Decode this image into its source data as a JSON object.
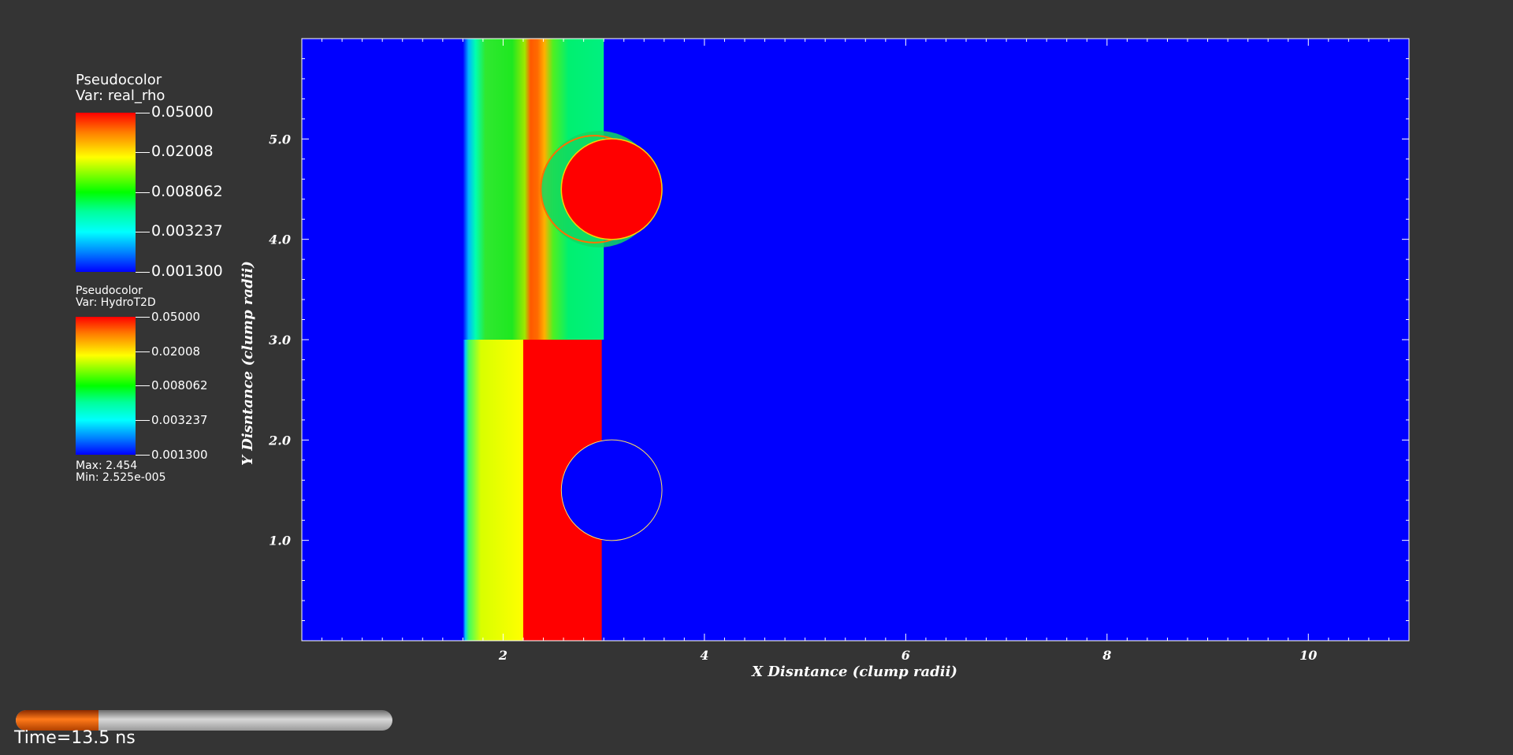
{
  "legend_top": {
    "title": "Pseudocolor",
    "var": "Var: real_rho",
    "ticks": [
      "0.05000",
      "0.02008",
      "0.008062",
      "0.003237",
      "0.001300"
    ]
  },
  "legend_bottom": {
    "title": "Pseudocolor",
    "var": "Var: HydroT2D",
    "ticks": [
      "0.05000",
      "0.02008",
      "0.008062",
      "0.003237",
      "0.001300"
    ],
    "max": "Max:  2.454",
    "min": "Min:  2.525e-005"
  },
  "time": {
    "label": "Time=13.5 ns",
    "progress": 0.22
  },
  "colors": {
    "background": "#343434",
    "field_low": "#0000ff",
    "field_high": "#ff0000",
    "progress_fill": "#ff7a1a"
  },
  "chart_data": {
    "type": "heatmap",
    "title": "",
    "xlabel": "X Disntance (clump radii)",
    "ylabel": "Y Disntance (clump radii)",
    "xlim": [
      0,
      11
    ],
    "ylim": [
      0,
      6
    ],
    "xticks": [
      2,
      4,
      6,
      8,
      10
    ],
    "xtick_labels": [
      "2",
      "4",
      "6",
      "8",
      "10"
    ],
    "yticks": [
      1,
      2,
      3,
      4,
      5
    ],
    "ytick_labels": [
      "1.0",
      "2.0",
      "3.0",
      "4.0",
      "5.0"
    ],
    "grid": false,
    "colormap": "rainbow (blue-cyan-green-yellow-red), log scale",
    "upper_panel": {
      "variable": "real_rho",
      "y_range": [
        3,
        6
      ],
      "shock_front_x": 3.0,
      "smooth_band_start_x": 1.6,
      "hot_band_x": [
        2.2,
        2.6
      ],
      "clump": {
        "x": 3.0,
        "y": 4.5,
        "radius": 0.5
      }
    },
    "lower_panel": {
      "variable": "HydroT2D",
      "y_range": [
        0,
        3
      ],
      "yellow_band_x": [
        1.6,
        2.2
      ],
      "red_band_x": [
        2.2,
        2.98
      ],
      "clump_cutout": {
        "x": 3.0,
        "y": 1.5,
        "radius": 0.5
      }
    }
  }
}
